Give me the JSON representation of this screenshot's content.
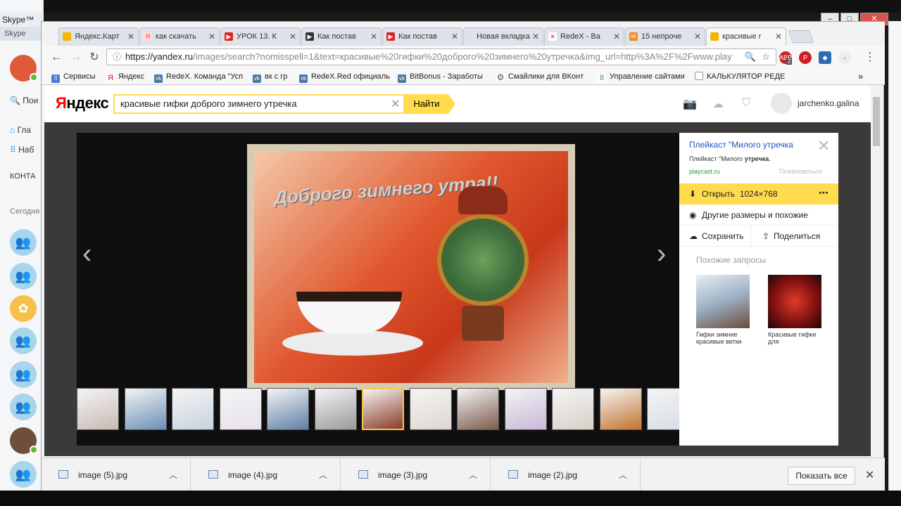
{
  "skype": {
    "title": "Skype™",
    "menu": "Skype",
    "search_label": "Пои",
    "home_label": "Гла",
    "nav_label": "Наб",
    "contacts_label": "КОНТА",
    "today_label": "Сегодня"
  },
  "tabs": [
    {
      "label": "Яндекс.Карт",
      "icon": "yandex-maps-icon",
      "color": "#f2b600"
    },
    {
      "label": "как скачать",
      "icon": "yandex-icon",
      "color": "#e44"
    },
    {
      "label": "УРОК 13. К",
      "icon": "youtube-icon",
      "color": "#e62117"
    },
    {
      "label": "Как постав",
      "icon": "play-icon",
      "color": "#333"
    },
    {
      "label": "Как постав",
      "icon": "youtube-icon",
      "color": "#e62117"
    },
    {
      "label": "Новая вкладка",
      "icon": "",
      "color": "#ddd"
    },
    {
      "label": "RedeX - Ва",
      "icon": "redex-icon",
      "color": "#c22"
    },
    {
      "label": "15 непроче",
      "icon": "mail-icon",
      "color": "#f08a24"
    },
    {
      "label": "красивые г",
      "icon": "yandex-images-icon",
      "color": "#f2b600"
    }
  ],
  "omnibox": {
    "host": "https://yandex.ru",
    "rest": "/images/search?nomisspell=1&text=красивые%20гифки%20доброго%20зимнего%20утречка&img_url=http%3A%2F%2Fwww.play"
  },
  "extensions": {
    "abp_badge": "2"
  },
  "bookmarks": [
    {
      "label": "Сервисы",
      "icon": "apps-icon",
      "color": "#4a7bd6"
    },
    {
      "label": "Яндекс",
      "icon": "yandex-icon",
      "color": "#e00"
    },
    {
      "label": "RedeX. Команда \"Усп",
      "icon": "vk-icon",
      "color": "#4a76a8"
    },
    {
      "label": "вк с гр",
      "icon": "vk-icon",
      "color": "#4a76a8"
    },
    {
      "label": "RedeX.Red официаль",
      "icon": "vk-icon",
      "color": "#4a76a8"
    },
    {
      "label": "BitBonus - Заработы",
      "icon": "vk-icon",
      "color": "#4a76a8"
    },
    {
      "label": "Смайлики для ВКонт",
      "icon": "gear-icon",
      "color": "#777"
    },
    {
      "label": "Управление сайтами",
      "icon": "uid-icon",
      "color": "#3a9a3a"
    },
    {
      "label": "КАЛЬКУЛЯТОР РЕДЕ",
      "icon": "doc-icon",
      "color": "#999"
    }
  ],
  "yandex": {
    "logo_main": "ндекс",
    "logo_first": "Я",
    "search_value": "красивые гифки доброго зимнего утречка",
    "find_button": "Найти",
    "username": "jarchenko.galina"
  },
  "panel": {
    "title": "Плейкаст \"Милого утречка",
    "description_prefix": "Плейкаст \"Милого ",
    "description_bold": "утречка",
    "description_suffix": ".",
    "domain": "playcast.ru",
    "report": "Пожаловаться",
    "open_label": "Открыть",
    "open_size": "1024×768",
    "other_sizes": "Другие размеры и похожие",
    "save": "Сохранить",
    "share": "Поделиться",
    "similar_title": "Похожие запросы",
    "similar": [
      {
        "label": "Гифки зимние красивые ветки"
      },
      {
        "label": "Красивые гифки для"
      }
    ]
  },
  "image": {
    "caption": "Доброго зимнего утра!!"
  },
  "thumbnails": [
    {
      "color": "#c9b9b3"
    },
    {
      "color": "#6a8fb8"
    },
    {
      "color": "#c7d3e0"
    },
    {
      "color": "#e7e2ea"
    },
    {
      "color": "#5f7fa8"
    },
    {
      "color": "#9a9a9a"
    },
    {
      "color": "#8a3b25",
      "selected": true
    },
    {
      "color": "#ddd7d1"
    },
    {
      "color": "#7c5a4c"
    },
    {
      "color": "#c8b8d8"
    },
    {
      "color": "#d9d0c8"
    },
    {
      "color": "#c1742f"
    },
    {
      "color": "#d6dde4"
    }
  ],
  "downloads": [
    {
      "name": "image (5).jpg"
    },
    {
      "name": "image (4).jpg"
    },
    {
      "name": "image (3).jpg"
    },
    {
      "name": "image (2).jpg"
    }
  ],
  "downloads_show_all": "Показать все"
}
